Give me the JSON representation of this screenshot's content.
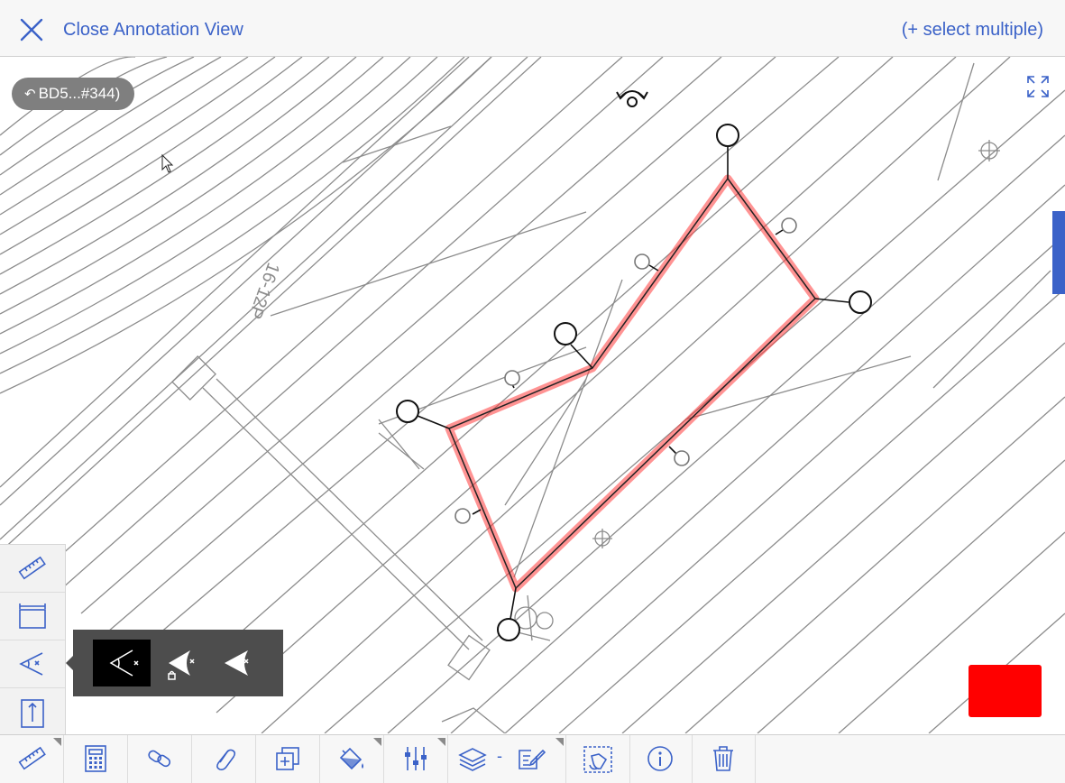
{
  "topbar": {
    "close_label": "Close Annotation View",
    "select_multiple_label": "(+ select multiple)"
  },
  "canvas": {
    "back_link_label": "BD5...#344)",
    "drawing_text": "16-12P",
    "annotation_color": "#ff0000",
    "accent_color": "#3b62c8"
  },
  "left_toolbar": {
    "tools": [
      "ruler-icon",
      "dimension-icon",
      "angle-icon",
      "vertical-measure-icon"
    ],
    "active_tool": "angle-icon"
  },
  "angle_flyout": {
    "options": [
      "angle-open-icon",
      "angle-filled-locked-icon",
      "angle-filled-icon"
    ],
    "selected": "angle-open-icon"
  },
  "bottom_toolbar": {
    "items": [
      "ruler-icon",
      "calculator-icon",
      "link-icon",
      "paperclip-icon",
      "duplicate-icon",
      "fill-bucket-icon",
      "sliders-icon",
      "layers-icon",
      "edit-note-icon",
      "lasso-select-icon",
      "info-icon",
      "trash-icon"
    ],
    "layer_separator": "-"
  }
}
